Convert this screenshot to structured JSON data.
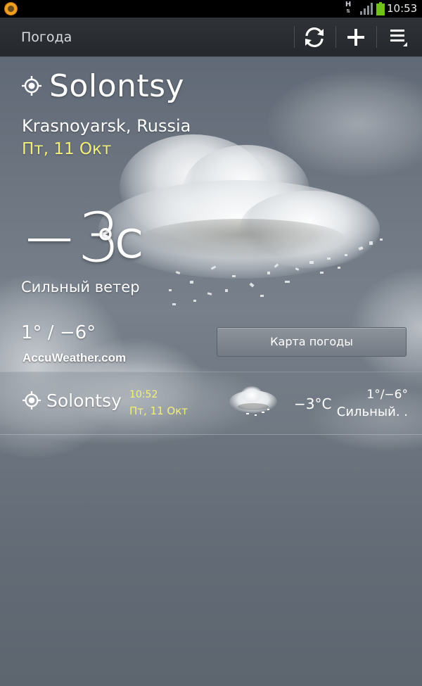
{
  "status_bar": {
    "network": "H",
    "time": "10:53"
  },
  "action_bar": {
    "title": "Погода",
    "refresh_icon": "refresh-icon",
    "add_icon": "plus-icon",
    "menu_icon": "menu-icon"
  },
  "current": {
    "city": "Solontsy",
    "region": "Krasnoyarsk, Russia",
    "date": "Пт, 11 Окт",
    "temperature": "−3",
    "unit": "°C",
    "condition": "Сильный ветер",
    "high_low": "1° / −6°",
    "brand": "AccuWeather.com",
    "map_button": "Карта погоды"
  },
  "city_list": [
    {
      "city": "Solontsy",
      "time": "10:52",
      "date": "Пт, 11 Окт",
      "temperature": "−3°C",
      "high_low": "1°/−6°",
      "condition": "Сильный. ."
    }
  ],
  "colors": {
    "accent_yellow": "#f2f07a",
    "action_bar": "#2a2e33",
    "battery": "#6fc21a"
  }
}
